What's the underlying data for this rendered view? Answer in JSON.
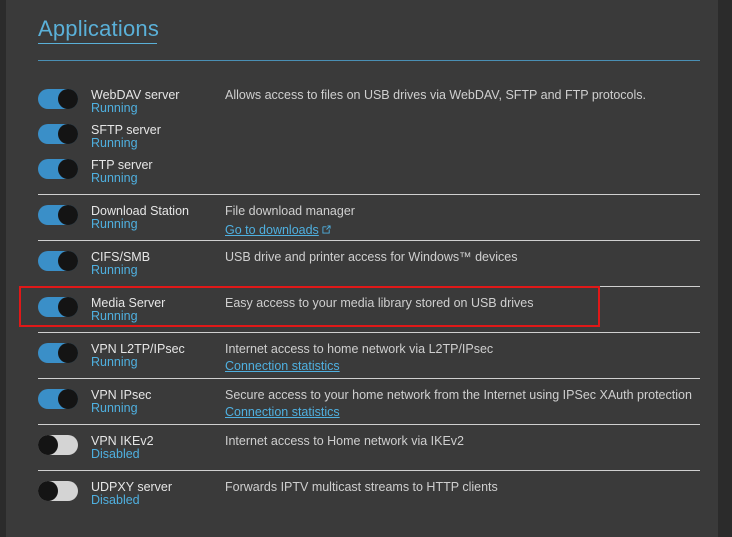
{
  "section": {
    "title": "Applications"
  },
  "apps": [
    {
      "name": "WebDAV server",
      "status": "Running",
      "enabled": true,
      "description": "Allows access to files on USB drives via WebDAV, SFTP and FTP protocols."
    },
    {
      "name": "SFTP server",
      "status": "Running",
      "enabled": true
    },
    {
      "name": "FTP server",
      "status": "Running",
      "enabled": true
    },
    {
      "name": "Download Station",
      "status": "Running",
      "enabled": true,
      "description": "File download manager",
      "link": "Go to downloads",
      "link_icon": "external-link-icon"
    },
    {
      "name": "CIFS/SMB",
      "status": "Running",
      "enabled": true,
      "description": "USB drive and printer access for Windows™ devices"
    },
    {
      "name": "Media Server",
      "status": "Running",
      "enabled": true,
      "description": "Easy access to your media library stored on USB drives",
      "highlight_color": "#e01818"
    },
    {
      "name": "VPN L2TP/IPsec",
      "status": "Running",
      "enabled": true,
      "description": "Internet access to home network via L2TP/IPsec",
      "link": "Connection statistics"
    },
    {
      "name": "VPN IPsec",
      "status": "Running",
      "enabled": true,
      "description": "Secure access to your home network from the Internet using IPSec XAuth protection",
      "link": "Connection statistics"
    },
    {
      "name": "VPN IKEv2",
      "status": "Disabled",
      "enabled": false,
      "description": "Internet access to Home network via IKEv2"
    },
    {
      "name": "UDPXY server",
      "status": "Disabled",
      "enabled": false,
      "description": "Forwards IPTV multicast streams to HTTP clients"
    }
  ],
  "colors": {
    "accent": "#3a8fc8",
    "status_text": "#4fb0e0",
    "toggle_off": "#d4d4d4",
    "highlight": "#e01818"
  }
}
